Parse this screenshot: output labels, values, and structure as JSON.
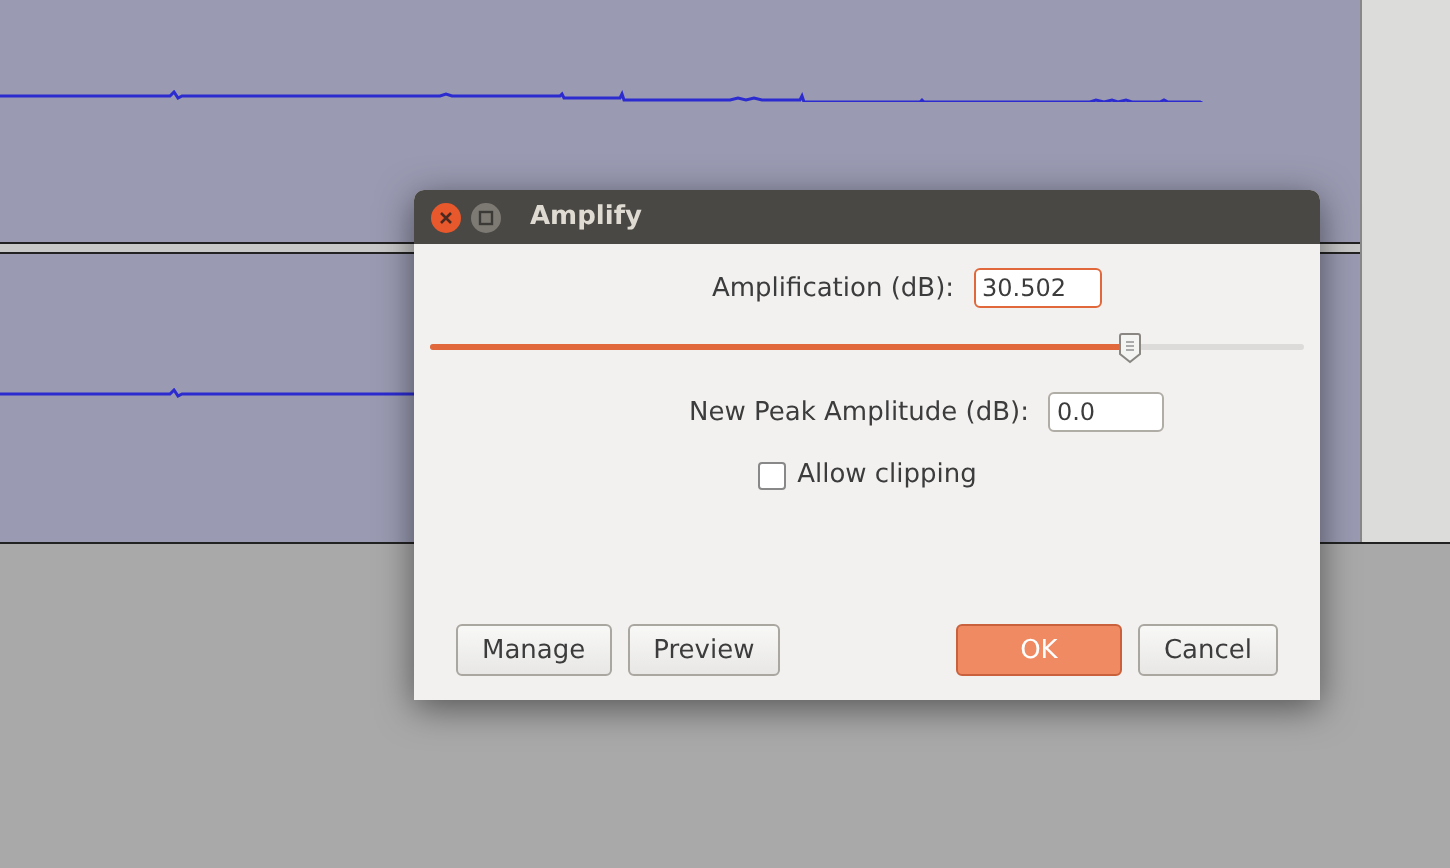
{
  "dialog": {
    "title": "Amplify",
    "amplification": {
      "label": "Amplification (dB):",
      "value": "30.502",
      "level": 0.8
    },
    "new_peak": {
      "label": "New Peak Amplitude (dB):",
      "value": "0.0"
    },
    "allow_clipping": {
      "label": "Allow clipping",
      "checked": false
    },
    "buttons": [
      {
        "label": "Manage",
        "kind": "normal"
      },
      {
        "label": "Preview",
        "kind": "normal"
      },
      {
        "label": "OK",
        "kind": "default"
      },
      {
        "label": "Cancel",
        "kind": "normal"
      }
    ]
  }
}
